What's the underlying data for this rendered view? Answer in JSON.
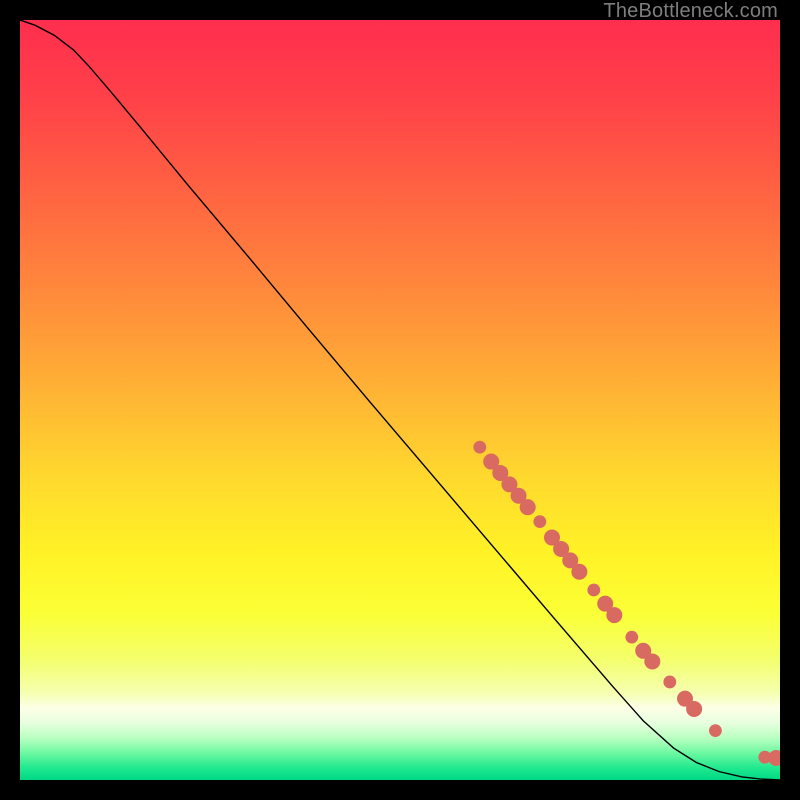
{
  "credit": "TheBottleneck.com",
  "chart_data": {
    "type": "line",
    "title": "",
    "xlabel": "",
    "ylabel": "",
    "xlim": [
      0,
      100
    ],
    "ylim": [
      0,
      100
    ],
    "grid": false,
    "legend": false,
    "curve": [
      {
        "x": 0,
        "y": 100.0
      },
      {
        "x": 2,
        "y": 99.3
      },
      {
        "x": 4.5,
        "y": 98.0
      },
      {
        "x": 7,
        "y": 96.1
      },
      {
        "x": 9,
        "y": 94.0
      },
      {
        "x": 12,
        "y": 90.5
      },
      {
        "x": 16,
        "y": 85.7
      },
      {
        "x": 22,
        "y": 78.4
      },
      {
        "x": 30,
        "y": 68.9
      },
      {
        "x": 38,
        "y": 59.3
      },
      {
        "x": 46,
        "y": 49.8
      },
      {
        "x": 54,
        "y": 40.4
      },
      {
        "x": 62,
        "y": 31.0
      },
      {
        "x": 70,
        "y": 21.6
      },
      {
        "x": 78,
        "y": 12.3
      },
      {
        "x": 82,
        "y": 7.8
      },
      {
        "x": 86,
        "y": 4.2
      },
      {
        "x": 89,
        "y": 2.3
      },
      {
        "x": 92,
        "y": 1.1
      },
      {
        "x": 95,
        "y": 0.4
      },
      {
        "x": 97.5,
        "y": 0.12
      },
      {
        "x": 100,
        "y": 0.0
      }
    ],
    "scatter": [
      {
        "x": 60.5,
        "y": 43.8,
        "r": 4
      },
      {
        "x": 62.0,
        "y": 41.9,
        "r": 5
      },
      {
        "x": 63.2,
        "y": 40.4,
        "r": 5
      },
      {
        "x": 64.4,
        "y": 38.9,
        "r": 5
      },
      {
        "x": 65.6,
        "y": 37.4,
        "r": 5
      },
      {
        "x": 66.8,
        "y": 35.9,
        "r": 5
      },
      {
        "x": 68.4,
        "y": 34.0,
        "r": 4
      },
      {
        "x": 70.0,
        "y": 31.9,
        "r": 5
      },
      {
        "x": 71.2,
        "y": 30.4,
        "r": 5
      },
      {
        "x": 72.4,
        "y": 28.9,
        "r": 5
      },
      {
        "x": 73.6,
        "y": 27.4,
        "r": 5
      },
      {
        "x": 75.5,
        "y": 25.0,
        "r": 4
      },
      {
        "x": 77.0,
        "y": 23.2,
        "r": 5
      },
      {
        "x": 78.2,
        "y": 21.7,
        "r": 5
      },
      {
        "x": 80.5,
        "y": 18.8,
        "r": 4
      },
      {
        "x": 82.0,
        "y": 17.0,
        "r": 5
      },
      {
        "x": 83.2,
        "y": 15.6,
        "r": 5
      },
      {
        "x": 85.5,
        "y": 12.9,
        "r": 4
      },
      {
        "x": 87.5,
        "y": 10.7,
        "r": 5
      },
      {
        "x": 88.7,
        "y": 9.35,
        "r": 5
      },
      {
        "x": 91.5,
        "y": 6.5,
        "r": 4
      },
      {
        "x": 98.0,
        "y": 3.0,
        "r": 4
      },
      {
        "x": 99.5,
        "y": 2.9,
        "r": 5
      }
    ],
    "scatter_color": "#d96a62",
    "curve_color": "#000000",
    "background_gradient": [
      {
        "stop": 0,
        "color": "#ff2e4e"
      },
      {
        "stop": 0.1,
        "color": "#ff4049"
      },
      {
        "stop": 0.22,
        "color": "#ff6142"
      },
      {
        "stop": 0.35,
        "color": "#ff873c"
      },
      {
        "stop": 0.48,
        "color": "#ffb035"
      },
      {
        "stop": 0.6,
        "color": "#ffd82e"
      },
      {
        "stop": 0.7,
        "color": "#fff226"
      },
      {
        "stop": 0.78,
        "color": "#fbff35"
      },
      {
        "stop": 0.84,
        "color": "#f4ff6b"
      },
      {
        "stop": 0.885,
        "color": "#f5ffb0"
      },
      {
        "stop": 0.905,
        "color": "#fdffe6"
      },
      {
        "stop": 0.925,
        "color": "#e7ffdf"
      },
      {
        "stop": 0.945,
        "color": "#b8ffc0"
      },
      {
        "stop": 0.965,
        "color": "#6bf8a1"
      },
      {
        "stop": 0.985,
        "color": "#1de88e"
      },
      {
        "stop": 1.0,
        "color": "#00d884"
      }
    ]
  }
}
